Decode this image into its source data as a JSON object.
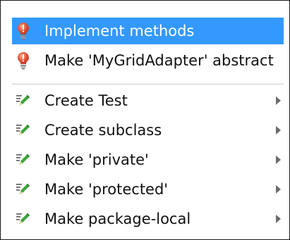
{
  "colors": {
    "selection_bg": "#3399ff",
    "selection_fg": "#ffffff",
    "bulb_red": "#e0523a",
    "bulb_orange": "#f08a3a",
    "pencil_green": "#3aa53a",
    "submenu_arrow": "#6a6a6a"
  },
  "menu": {
    "items": [
      {
        "label": "Implement methods",
        "icon": "red-bulb-icon",
        "selected": true,
        "submenu": false
      },
      {
        "label": "Make 'MyGridAdapter' abstract",
        "icon": "red-bulb-icon",
        "selected": false,
        "submenu": false
      },
      {
        "label": "Create Test",
        "icon": "intention-pencil-icon",
        "selected": false,
        "submenu": true
      },
      {
        "label": "Create subclass",
        "icon": "intention-pencil-icon",
        "selected": false,
        "submenu": true
      },
      {
        "label": "Make 'private'",
        "icon": "intention-pencil-icon",
        "selected": false,
        "submenu": true
      },
      {
        "label": "Make 'protected'",
        "icon": "intention-pencil-icon",
        "selected": false,
        "submenu": true
      },
      {
        "label": "Make package-local",
        "icon": "intention-pencil-icon",
        "selected": false,
        "submenu": true
      }
    ]
  }
}
